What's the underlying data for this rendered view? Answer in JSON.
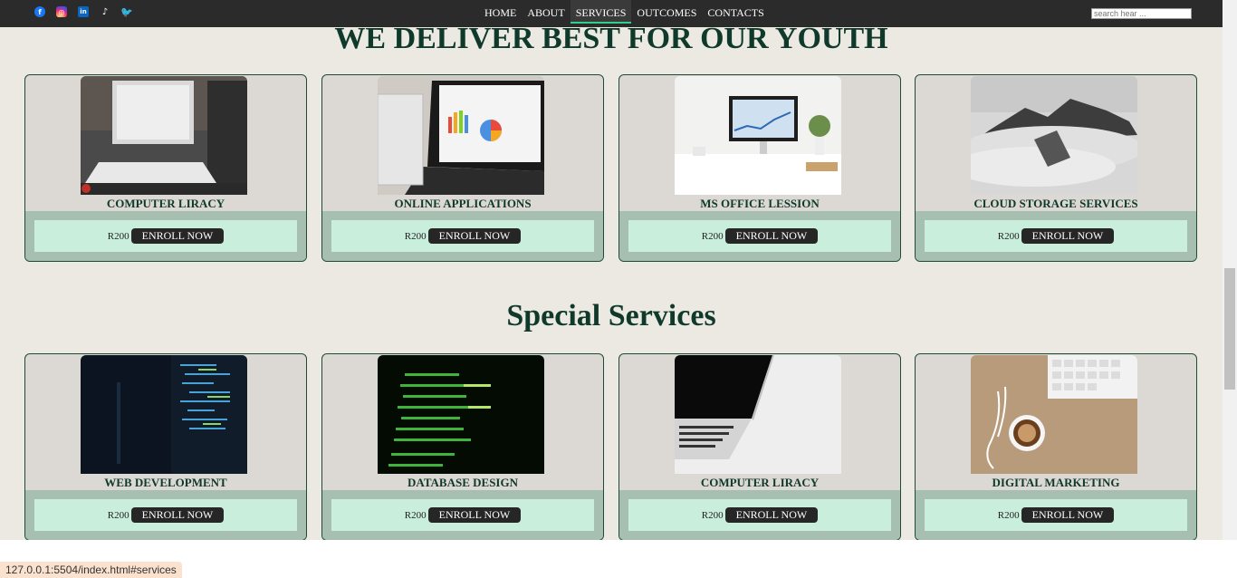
{
  "nav": {
    "items": [
      "HOME",
      "ABOUT",
      "SERVICES",
      "OUTCOMES",
      "CONTACTS"
    ],
    "active": "SERVICES",
    "search_placeholder": "search hear ..."
  },
  "socials": [
    "facebook-icon",
    "instagram-icon",
    "linkedin-icon",
    "tiktok-icon",
    "twitter-icon"
  ],
  "section1": {
    "heading": "WE DELIVER BEST FOR OUR YOUTH",
    "cards": [
      {
        "title": "COMPUTER LIRACY",
        "price": "R200",
        "button": "ENROLL NOW"
      },
      {
        "title": "ONLINE APPLICATIONS",
        "price": "R200",
        "button": "ENROLL NOW"
      },
      {
        "title": "MS OFFICE LESSION",
        "price": "R200",
        "button": "ENROLL NOW"
      },
      {
        "title": "CLOUD STORAGE SERVICES",
        "price": "R200",
        "button": "ENROLL NOW"
      }
    ]
  },
  "section2": {
    "heading": "Special Services",
    "cards": [
      {
        "title": "WEB DEVELOPMENT",
        "price": "R200",
        "button": "ENROLL NOW"
      },
      {
        "title": "DATABASE DESIGN",
        "price": "R200",
        "button": "ENROLL NOW"
      },
      {
        "title": "COMPUTER LIRACY",
        "price": "R200",
        "button": "ENROLL NOW"
      },
      {
        "title": "DIGITAL MARKETING",
        "price": "R200",
        "button": "ENROLL NOW"
      }
    ]
  },
  "status_url": "127.0.0.1:5504/index.html#services",
  "colors": {
    "heading": "#0f3a2b",
    "nav_bg": "#2b2b2b",
    "page_bg": "#ece9e3",
    "card_footer": "#a7bfb0",
    "card_inner": "#c9efdc",
    "active_underline": "#2fd08a"
  }
}
